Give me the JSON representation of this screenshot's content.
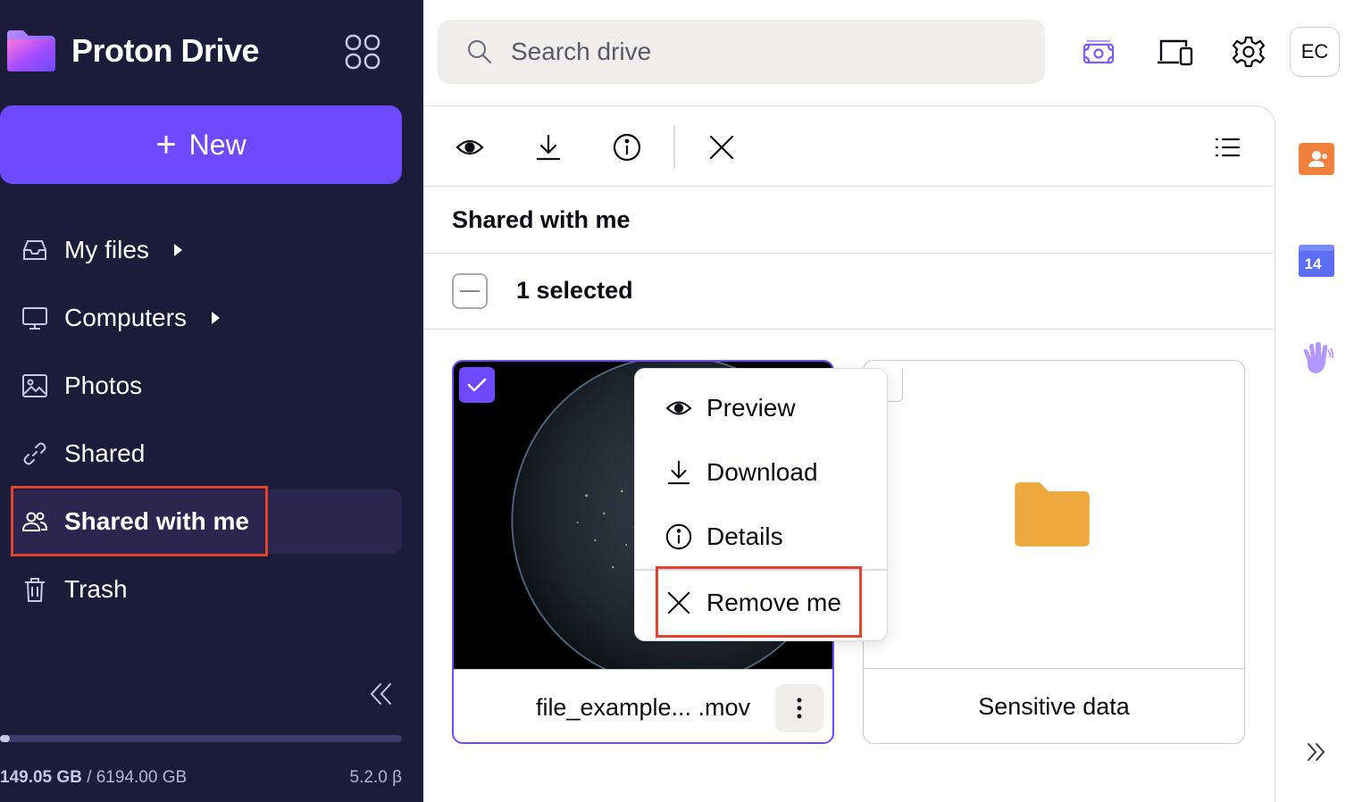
{
  "app": {
    "brand": "Proton Drive",
    "colors": {
      "sidebar_bg": "#1c1b3a",
      "accent": "#6d4aff",
      "highlight": "#e0452c",
      "folder": "#eda93f"
    }
  },
  "sidebar": {
    "new_label": "New",
    "items": [
      {
        "label": "My files",
        "icon": "inbox-icon",
        "has_caret": true
      },
      {
        "label": "Computers",
        "icon": "monitor-icon",
        "has_caret": true
      },
      {
        "label": "Photos",
        "icon": "image-icon",
        "has_caret": false
      },
      {
        "label": "Shared",
        "icon": "link-icon",
        "has_caret": false
      },
      {
        "label": "Shared with me",
        "icon": "users-icon",
        "has_caret": false,
        "active": true
      },
      {
        "label": "Trash",
        "icon": "trash-icon",
        "has_caret": false
      }
    ],
    "storage_used": "149.05 GB",
    "storage_total": "/ 6194.00 GB",
    "storage_fraction": 0.024,
    "version": "5.2.0 β"
  },
  "header": {
    "search_placeholder": "Search drive",
    "avatar_initials": "EC"
  },
  "main": {
    "section_title": "Shared with me",
    "selection_label": "1 selected",
    "cards": [
      {
        "name": "file_example... .mov",
        "selected": true,
        "kind": "video"
      },
      {
        "name": "Sensitive data",
        "selected": false,
        "kind": "folder"
      }
    ]
  },
  "context_menu": {
    "items": [
      {
        "label": "Preview",
        "icon": "eye-icon"
      },
      {
        "label": "Download",
        "icon": "download-icon"
      },
      {
        "label": "Details",
        "icon": "info-icon"
      },
      {
        "label": "Remove me",
        "icon": "close-icon"
      }
    ]
  },
  "rail": {
    "calendar_day": "14"
  }
}
